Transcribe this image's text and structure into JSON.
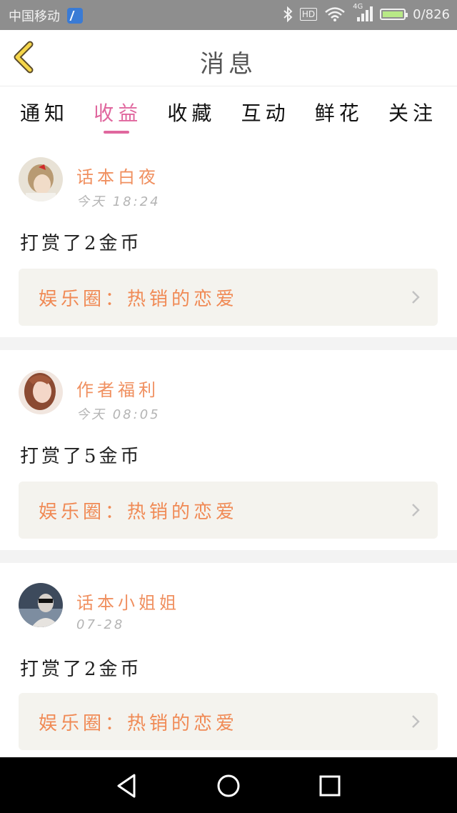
{
  "status_bar": {
    "carrier": "中国移动",
    "network": "4G",
    "hd": "HD",
    "speed": "0/826"
  },
  "header": {
    "title": "消息"
  },
  "tabs": [
    {
      "label": "通知",
      "active": false
    },
    {
      "label": "收益",
      "active": true
    },
    {
      "label": "收藏",
      "active": false
    },
    {
      "label": "互动",
      "active": false
    },
    {
      "label": "鲜花",
      "active": false
    },
    {
      "label": "关注",
      "active": false
    }
  ],
  "messages": [
    {
      "user": "话本白夜",
      "time": "今天 18:24",
      "text": "打赏了2金币",
      "link": "娱乐圈：热销的恋爱"
    },
    {
      "user": "作者福利",
      "time": "今天 08:05",
      "text": "打赏了5金币",
      "link": "娱乐圈：热销的恋爱"
    },
    {
      "user": "话本小姐姐",
      "time": "07-28",
      "text": "打赏了2金币",
      "link": "娱乐圈：热销的恋爱"
    }
  ],
  "colors": {
    "accent": "#e0679e",
    "username": "#f09060",
    "link_text": "#f08a55",
    "link_bg": "#f4f3ee"
  }
}
